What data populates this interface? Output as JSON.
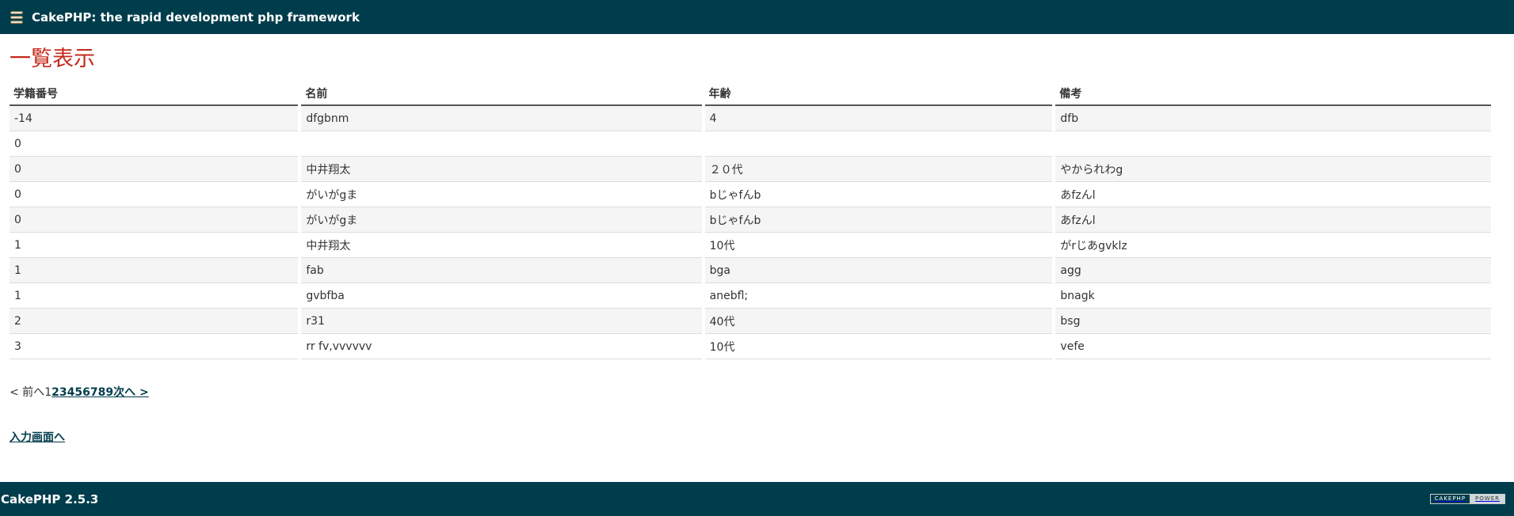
{
  "header": {
    "title": "CakePHP: the rapid development php framework",
    "icon": "cake-stack-icon"
  },
  "page": {
    "title": "一覧表示"
  },
  "table": {
    "columns": [
      "学籍番号",
      "名前",
      "年齢",
      "備考"
    ],
    "rows": [
      [
        "-14",
        "dfgbnm",
        "4",
        "dfb"
      ],
      [
        "0",
        "",
        "",
        ""
      ],
      [
        "0",
        "中井翔太",
        "２０代",
        "やかられわg"
      ],
      [
        "0",
        "がいがgま",
        "bじゃfんb",
        "あfzんl"
      ],
      [
        "0",
        "がいがgま",
        "bじゃfんb",
        "あfzんl"
      ],
      [
        "1",
        "中井翔太",
        "10代",
        "がrじあgvklz"
      ],
      [
        "1",
        "fab",
        "bga",
        "agg"
      ],
      [
        "1",
        "gvbfba",
        "anebfl;",
        "bnagk"
      ],
      [
        "2",
        "r31",
        "40代",
        "bsg"
      ],
      [
        "3",
        "rr fv,vvvvvv",
        "10代",
        "vefe"
      ]
    ]
  },
  "paging": {
    "prev": "< 前へ",
    "current": "1",
    "pages": [
      "2",
      "3",
      "4",
      "5",
      "6",
      "7",
      "8",
      "9"
    ],
    "next": "次へ >"
  },
  "links": {
    "input": "入力画面へ"
  },
  "footer": {
    "version": "CakePHP 2.5.3",
    "badge_left": "CAKEPHP",
    "badge_right": "POWER"
  },
  "colors": {
    "header_bg": "#003d4c",
    "title_red": "#c6291d",
    "link": "#003d4c"
  }
}
